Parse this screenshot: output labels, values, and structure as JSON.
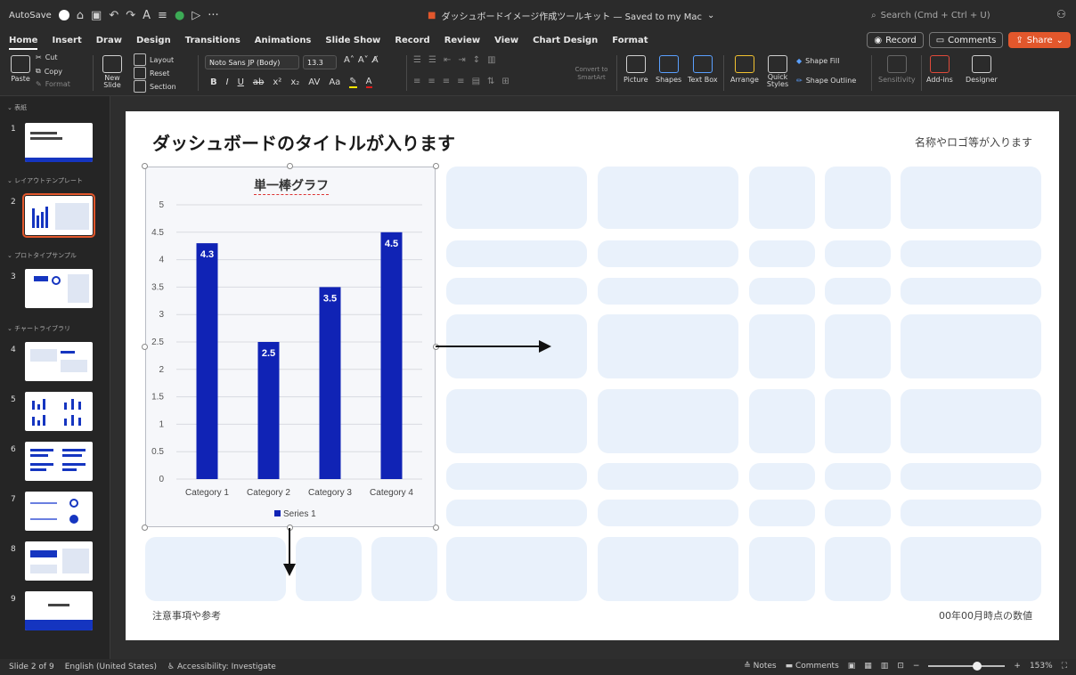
{
  "titlebar": {
    "autosave": "AutoSave",
    "doc_title": "ダッシュボードイメージ作成ツールキット — Saved to my Mac",
    "search_placeholder": "Search (Cmd + Ctrl + U)"
  },
  "tabs": [
    "Home",
    "Insert",
    "Draw",
    "Design",
    "Transitions",
    "Animations",
    "Slide Show",
    "Record",
    "Review",
    "View",
    "Chart Design",
    "Format"
  ],
  "tabs_right": {
    "record": "Record",
    "comments": "Comments",
    "share": "Share"
  },
  "ribbon": {
    "paste": "Paste",
    "cut": "Cut",
    "copy": "Copy",
    "format": "Format",
    "new_slide": "New Slide",
    "layout": "Layout",
    "reset": "Reset",
    "section": "Section",
    "font": "Noto Sans JP (Body)",
    "size": "13.3",
    "convert": "Convert to SmartArt",
    "picture": "Picture",
    "shapes": "Shapes",
    "textbox": "Text Box",
    "arrange": "Arrange",
    "quick_styles": "Quick Styles",
    "shape_fill": "Shape Fill",
    "shape_outline": "Shape Outline",
    "sensitivity": "Sensitivity",
    "addins": "Add-ins",
    "designer": "Designer"
  },
  "panel": {
    "sections": [
      "表紙",
      "レイアウトテンプレート",
      "プロトタイプサンプル",
      "チャートライブラリ"
    ],
    "slide_numbers": [
      "1",
      "2",
      "3",
      "4",
      "5",
      "6",
      "7",
      "8",
      "9"
    ]
  },
  "slide": {
    "title": "ダッシュボードのタイトルが入ります",
    "subtitle": "名称やロゴ等が入ります",
    "note": "注意事項や参考",
    "date": "00年00月時点の数値"
  },
  "chart_data": {
    "type": "bar",
    "title": "単一棒グラフ",
    "categories": [
      "Category 1",
      "Category 2",
      "Category 3",
      "Category 4"
    ],
    "series": [
      {
        "name": "Series 1",
        "values": [
          4.3,
          2.5,
          3.5,
          4.5
        ],
        "color": "#1023b5"
      }
    ],
    "ylim": [
      0,
      5
    ],
    "yticks": [
      "0",
      "0.5",
      "1",
      "1.5",
      "2",
      "2.5",
      "3",
      "3.5",
      "4",
      "4.5",
      "5"
    ],
    "grid": true,
    "legend": "bottom",
    "data_labels": [
      "4.3",
      "2.5",
      "3.5",
      "4.5"
    ]
  },
  "statusbar": {
    "slide": "Slide 2 of 9",
    "language": "English (United States)",
    "accessibility": "Accessibility: Investigate",
    "notes": "Notes",
    "comments": "Comments",
    "zoom": "153%"
  }
}
